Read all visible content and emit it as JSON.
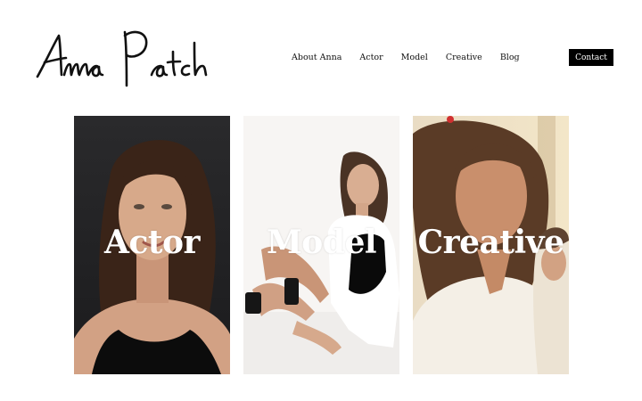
{
  "brand": {
    "logo_text": "Anna Patch"
  },
  "nav": {
    "items": [
      {
        "label": "About Anna"
      },
      {
        "label": "Actor"
      },
      {
        "label": "Model"
      },
      {
        "label": "Creative"
      },
      {
        "label": "Blog"
      }
    ]
  },
  "contact": {
    "label": "Contact"
  },
  "cards": [
    {
      "label": "Actor"
    },
    {
      "label": "Model"
    },
    {
      "label": "Creative"
    }
  ],
  "colors": {
    "text": "#111111",
    "button_bg": "#000000",
    "button_text": "#ffffff"
  }
}
